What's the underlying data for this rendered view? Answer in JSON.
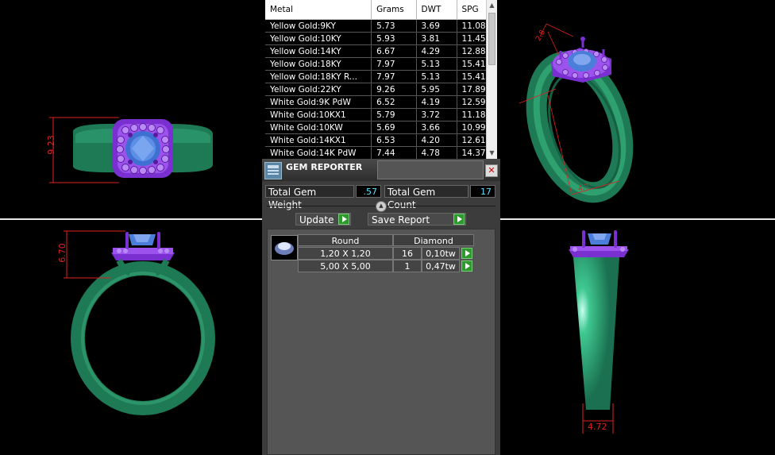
{
  "metal_table": {
    "columns": [
      "Metal",
      "Grams",
      "DWT",
      "SPG"
    ],
    "rows": [
      [
        "Yellow Gold:9KY",
        "5.73",
        "3.69",
        "11.08"
      ],
      [
        "Yellow Gold:10KY",
        "5.93",
        "3.81",
        "11.45"
      ],
      [
        "Yellow Gold:14KY",
        "6.67",
        "4.29",
        "12.88"
      ],
      [
        "Yellow Gold:18KY",
        "7.97",
        "5.13",
        "15.41"
      ],
      [
        "Yellow Gold:18KY R...",
        "7.97",
        "5.13",
        "15.41"
      ],
      [
        "Yellow Gold:22KY",
        "9.26",
        "5.95",
        "17.89"
      ],
      [
        "White Gold:9K PdW",
        "6.52",
        "4.19",
        "12.59"
      ],
      [
        "White Gold:10KX1",
        "5.79",
        "3.72",
        "11.18"
      ],
      [
        "White Gold:10KW",
        "5.69",
        "3.66",
        "10.99"
      ],
      [
        "White Gold:14KX1",
        "6.53",
        "4.20",
        "12.61"
      ],
      [
        "White Gold:14K PdW",
        "7.44",
        "4.78",
        "14.37"
      ]
    ]
  },
  "gem_reporter": {
    "title": "GEM REPORTER",
    "close_symbol": "✕",
    "total_weight_label": "Total Gem Weight",
    "total_weight_value": ".57",
    "total_count_label": "Total Gem Count",
    "total_count_value": "17",
    "update_label": "Update",
    "save_report_label": "Save Report",
    "headers": {
      "shape": "Round",
      "stone": "Diamond"
    },
    "stones": [
      {
        "size": "1,20 X 1,20",
        "count": "16",
        "weight": "0,10tw"
      },
      {
        "size": "5,00 X 5,00",
        "count": "1",
        "weight": "0,47tw"
      }
    ]
  },
  "dimensions": {
    "top_left": "9.23",
    "top_right_a": "2.8",
    "top_right_b": "4.7",
    "bottom_left": "6.70",
    "bottom_right": "4.72"
  },
  "colors": {
    "band": "#1e7a55",
    "setting": "#8a2be2",
    "stone": "#4a7ed8",
    "dimension": "#e02020"
  }
}
